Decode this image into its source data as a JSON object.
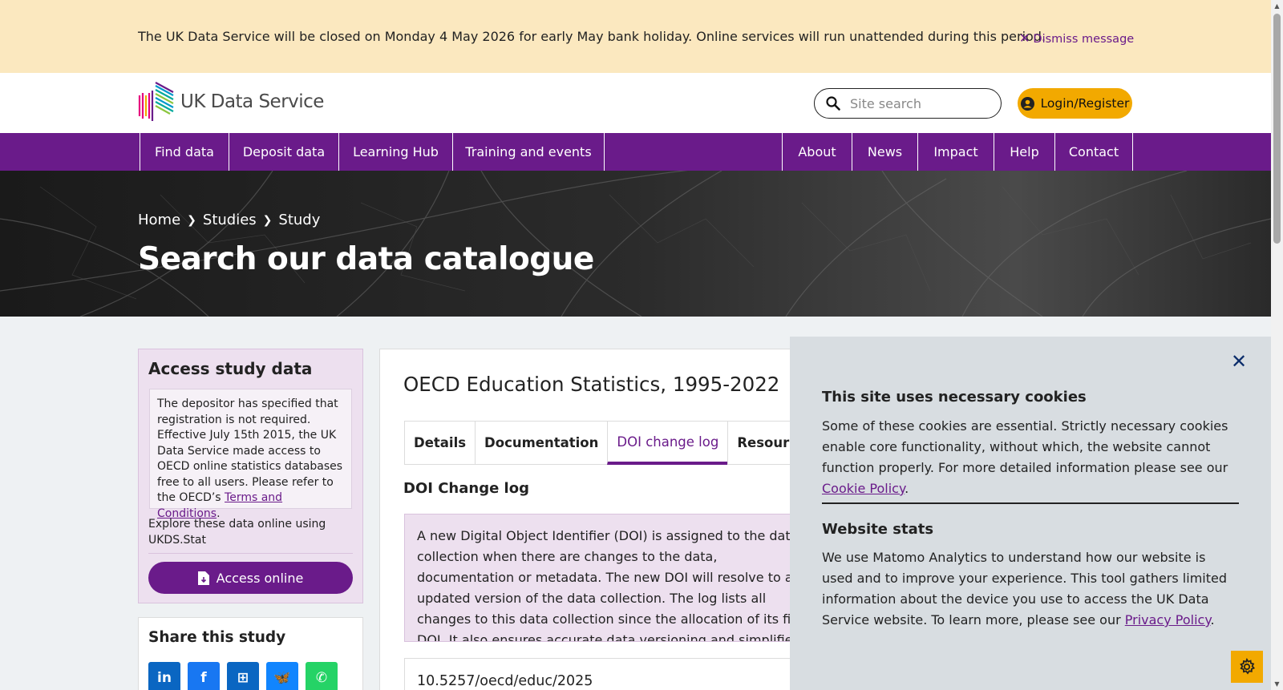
{
  "banner": {
    "message": "The UK Data Service will be closed on Monday 4 May 2026 for early May bank holiday. Online services will run unattended during this period.",
    "dismiss_label": "Dismiss message"
  },
  "header": {
    "logo_text": "UK Data Service",
    "search_placeholder": "Site search",
    "login_label": "Login/Register"
  },
  "nav": {
    "left_items": [
      "Find data",
      "Deposit data",
      "Learning Hub",
      "Training and events"
    ],
    "right_items": [
      "About",
      "News",
      "Impact",
      "Help",
      "Contact"
    ]
  },
  "hero": {
    "breadcrumb": [
      "Home",
      "Studies",
      "Study"
    ],
    "title": "Search our data catalogue"
  },
  "sidebar": {
    "access_title": "Access study data",
    "access_note_text": "The depositor has specified that registration is not required. Effective July 15th 2015, the UK Data Service made access to OECD online statistics databases free to all users. Please refer to the OECD’s ",
    "access_note_link": "Terms and Conditions",
    "access_note_end": ".",
    "explore_text": "Explore these data online using UKDS.Stat",
    "access_button": "Access online",
    "share_title": "Share this study",
    "share_services": [
      {
        "name": "linkedin",
        "glyph": "in",
        "color": "#0a66c2"
      },
      {
        "name": "facebook",
        "glyph": "f",
        "color": "#1877f2"
      },
      {
        "name": "microsoft",
        "glyph": "⊞",
        "color": "#0a66c2"
      },
      {
        "name": "bluesky",
        "glyph": "🦋",
        "color": "#1185fe"
      },
      {
        "name": "whatsapp",
        "glyph": "✆",
        "color": "#25d366"
      }
    ]
  },
  "study": {
    "title": "OECD Education Statistics, 1995-2022",
    "tabs": [
      "Details",
      "Documentation",
      "DOI change log",
      "Resources"
    ],
    "active_tab": "DOI change log",
    "section_heading": "DOI Change log",
    "info_text": "A new Digital Object Identifier (DOI) is assigned to the data collection when there are changes to the data, documentation or metadata. The new DOI will resolve to an updated version of the data collection. The log lists all changes to this data collection since the allocation of its first DOI. It also ensures accurate data versioning and simplifies citation for users of data collections. Data producers and depositors can continue to receive credit for their work.",
    "doi": "10.5257/oecd/educ/2025"
  },
  "cookie": {
    "heading_1": "This site uses necessary cookies",
    "text_1": "Some of these cookies are essential. Strictly necessary cookies enable core functionality, without which, the website cannot function properly. For more detailed information please see our ",
    "link_1": "Cookie Policy",
    "end_1": ".",
    "heading_2": "Website stats",
    "text_2": "We use Matomo Analytics to understand how our website is used and to improve your experience. This tool gathers limited information about the device you use to access the UK Data Service website. To learn more, please see our ",
    "link_2": "Privacy Policy",
    "end_2": "."
  },
  "colors": {
    "brand_purple": "#6a1b8a",
    "accent_yellow": "#f2a900",
    "banner_bg": "#fbe8bf"
  }
}
